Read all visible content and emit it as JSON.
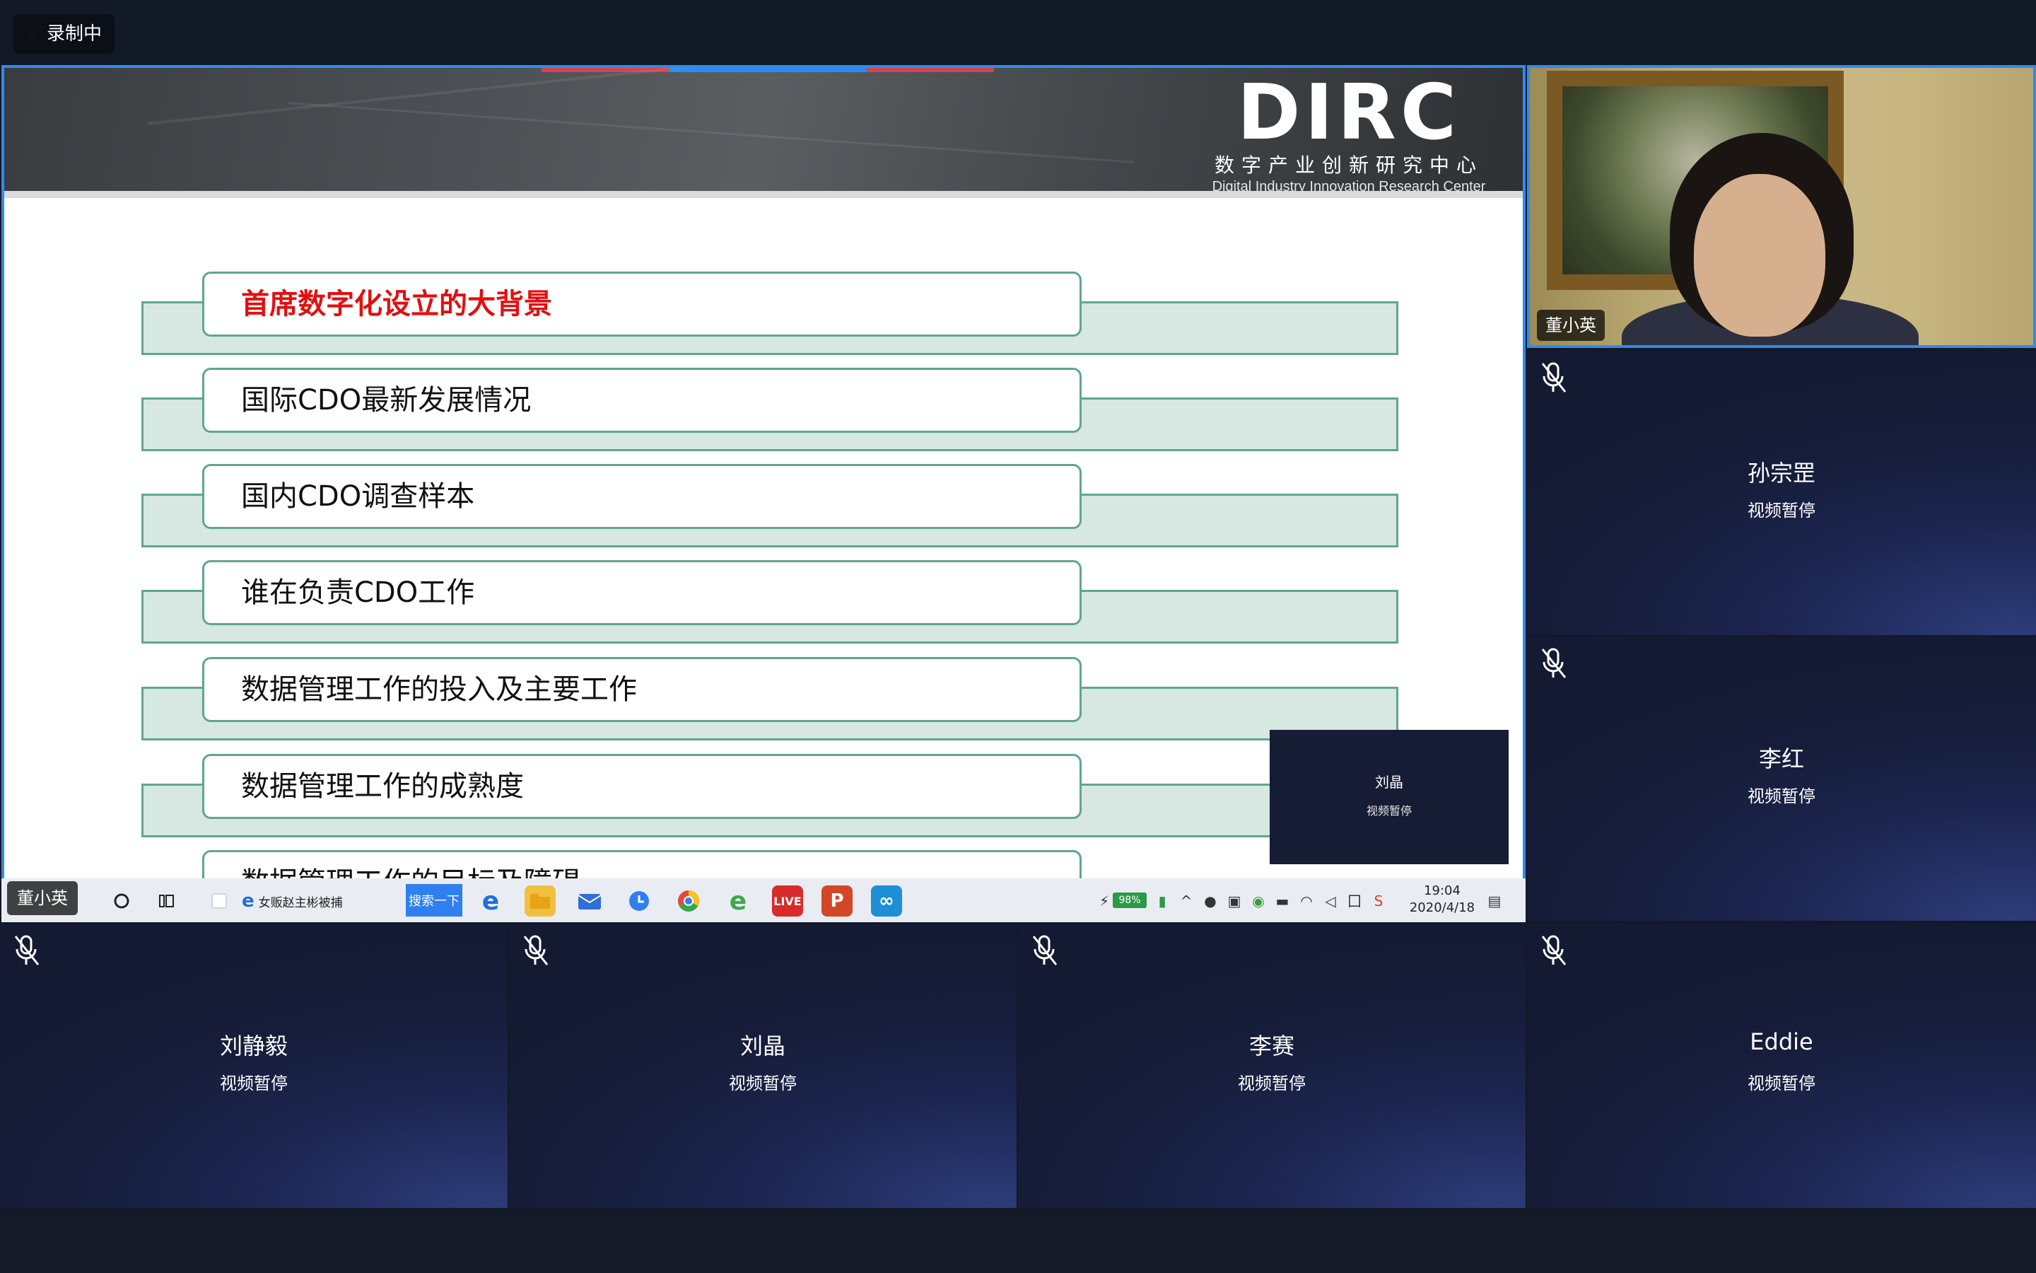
{
  "recording": {
    "label": "录制中"
  },
  "slide": {
    "logo": {
      "main": "DIRC",
      "cn": "数字产业创新研究中心",
      "en": "Digital Industry Innovation Research Center"
    },
    "agenda": [
      {
        "label": "首席数字化设立的大背景",
        "active": true
      },
      {
        "label": "国际CDO最新发展情况",
        "active": false
      },
      {
        "label": "国内CDO调查样本",
        "active": false
      },
      {
        "label": "谁在负责CDO工作",
        "active": false
      },
      {
        "label": "数据管理工作的投入及主要工作",
        "active": false
      },
      {
        "label": "数据管理工作的成熟度",
        "active": false
      },
      {
        "label": "数据管理工作的目标及障碍",
        "active": false
      }
    ],
    "mini_tile": {
      "name": "刘晶",
      "status": "视频暂停"
    }
  },
  "taskbar": {
    "browser_tab": "女贩赵主彬被捕",
    "search_button": "搜索一下",
    "battery": "98%",
    "time": "19:04",
    "date": "2020/4/18"
  },
  "presenter_tag": "董小英",
  "camera": {
    "name": "董小英"
  },
  "participants": [
    {
      "name": "孙宗罡",
      "status": "视频暂停"
    },
    {
      "name": "李红",
      "status": "视频暂停"
    },
    {
      "name": "刘静毅",
      "status": "视频暂停"
    },
    {
      "name": "刘晶",
      "status": "视频暂停"
    },
    {
      "name": "李赛",
      "status": "视频暂停"
    },
    {
      "name": "Eddie",
      "status": "视频暂停"
    }
  ],
  "colors": {
    "share_border": "#2d8cf0",
    "agenda_band": "#d7e7e2",
    "agenda_border": "#5fa690",
    "active_text": "#e30f0f",
    "tile_bg": "#161d3a"
  }
}
